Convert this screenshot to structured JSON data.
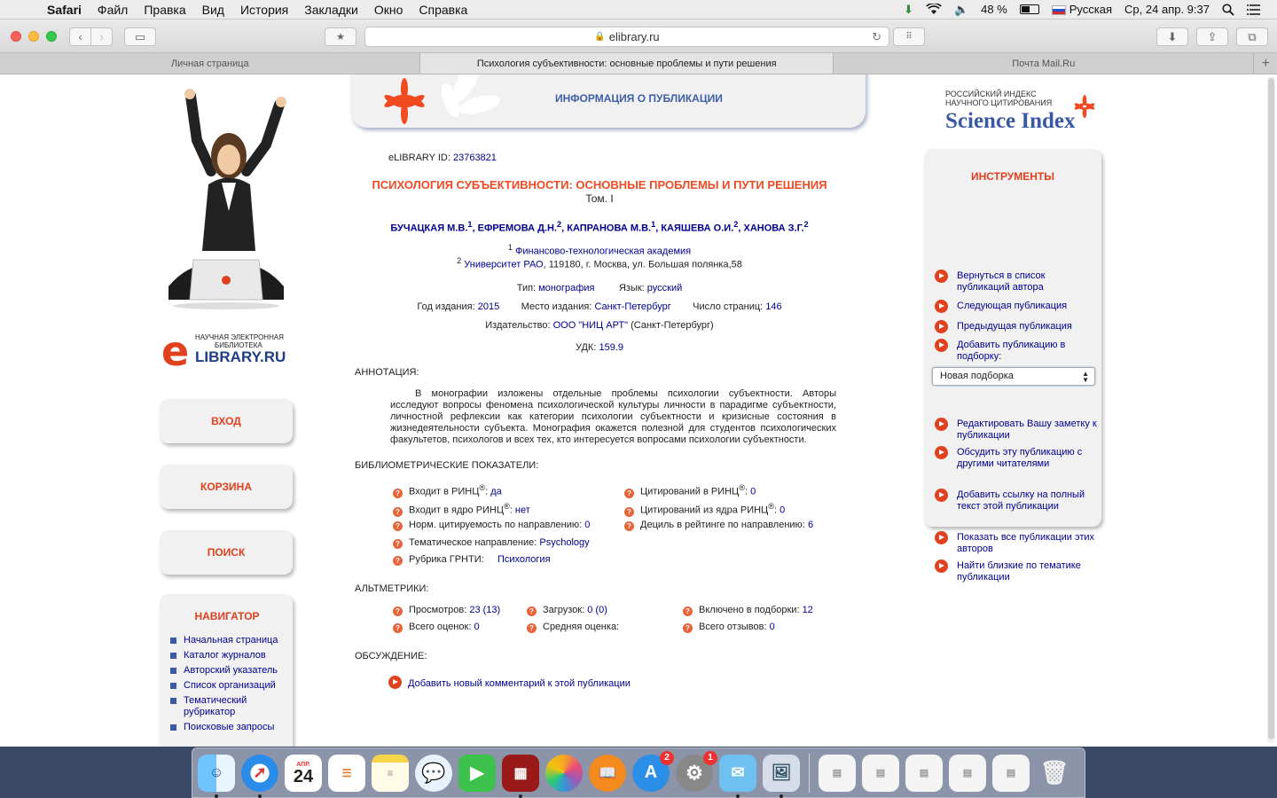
{
  "menubar": {
    "app": "Safari",
    "items": [
      "Файл",
      "Правка",
      "Вид",
      "История",
      "Закладки",
      "Окно",
      "Справка"
    ],
    "battery": "48 %",
    "input_source": "Русская",
    "datetime": "Ср, 24 апр.  9:37"
  },
  "browser": {
    "url": "elibrary.ru",
    "tabs": [
      {
        "label": "Личная страница"
      },
      {
        "label": "Психология субъективности: основные проблемы и пути решения"
      },
      {
        "label": "Почта Mail.Ru"
      }
    ]
  },
  "left": {
    "logo_small_line1": "НАУЧНАЯ ЭЛЕКТРОННАЯ",
    "logo_small_line2": "БИБЛИОТЕКА",
    "logo_big": "LIBRARY.RU",
    "logo_e": "e",
    "login": "ВХОД",
    "cart": "КОРЗИНА",
    "search": "ПОИСК",
    "navigator_title": "НАВИГАТОР",
    "nav_items": [
      "Начальная страница",
      "Каталог журналов",
      "Авторский указатель",
      "Список организаций",
      "Тематический рубрикатор",
      "Поисковые запросы"
    ]
  },
  "header": {
    "title": "ИНФОРМАЦИЯ О ПУБЛИКАЦИИ"
  },
  "publication": {
    "id_label": "eLIBRARY ID:",
    "id_value": "23763821",
    "title": "ПСИХОЛОГИЯ СУБЪЕКТИВНОСТИ: ОСНОВНЫЕ ПРОБЛЕМЫ И ПУТИ РЕШЕНИЯ",
    "volume": "Том. I",
    "authors": [
      {
        "name": "БУЧАЦКАЯ М.В.",
        "sup": "1"
      },
      {
        "name": "ЕФРЕМОВА Д.Н.",
        "sup": "2"
      },
      {
        "name": "КАПРАНОВА М.В.",
        "sup": "1"
      },
      {
        "name": "КАЯШЕВА О.И.",
        "sup": "2"
      },
      {
        "name": "ХАНОВА З.Г.",
        "sup": "2"
      }
    ],
    "aff1_sup": "1",
    "aff1": "Финансово-технологическая академия",
    "aff2_sup": "2",
    "aff2_link": "Университет РАО",
    "aff2_rest": ", 119180, г. Москва, ул. Большая полянка,58",
    "type_label": "Тип:",
    "type_value": "монография",
    "lang_label": "Язык:",
    "lang_value": "русский",
    "year_label": "Год издания:",
    "year_value": "2015",
    "place_label": "Место издания:",
    "place_value": "Санкт-Петербург",
    "pages_label": "Число страниц:",
    "pages_value": "146",
    "publisher_label": "Издательство:",
    "publisher_value": "ООО \"НИЦ АРТ\"",
    "publisher_city": "(Санкт-Петербург)",
    "udk_label": "УДК:",
    "udk_value": "159.9",
    "annotation_head": "АННОТАЦИЯ:",
    "annotation": "В монографии изложены отдельные проблемы психологии субъектности. Авторы исследуют вопросы феномена психологической культуры личности в парадигме субъектности, личностной рефлексии как категории психологии субъектности и кризисные состояния в жизнедеятельности субъекта. Монография окажется полезной для студентов психологических факультетов, психологов и всех тех, кто интересуется вопросами психологии субъектности."
  },
  "biblio": {
    "head": "БИБЛИОМЕТРИЧЕСКИЕ ПОКАЗАТЕЛИ:",
    "rinc_label": "Входит в РИНЦ",
    "rinc_value": "да",
    "core_label": "Входит в ядро РИНЦ",
    "core_value": "нет",
    "norm_label": "Норм. цитируемость по направлению:",
    "norm_value": "0",
    "topic_label": "Тематическое направление:",
    "topic_value": "Psychology",
    "grnti_label": "Рубрика ГРНТИ:",
    "grnti_value": "Психология",
    "cit_label": "Цитирований в РИНЦ",
    "cit_value": "0",
    "cit_core_label": "Цитирований из ядра РИНЦ",
    "cit_core_value": "0",
    "decile_label": "Дециль в рейтинге по направлению:",
    "decile_value": "6",
    "reg": "®"
  },
  "altmetrics": {
    "head": "АЛЬТМЕТРИКИ:",
    "views_label": "Просмотров:",
    "views_value": "23 (13)",
    "downloads_label": "Загрузок:",
    "downloads_value": "0 (0)",
    "collections_label": "Включено в подборки:",
    "collections_value": "12",
    "ratings_label": "Всего оценок:",
    "ratings_value": "0",
    "avg_label": "Средняя оценка:",
    "reviews_label": "Всего отзывов:",
    "reviews_value": "0"
  },
  "discussion": {
    "head": "ОБСУЖДЕНИЕ:",
    "add_comment": "Добавить новый комментарий к этой публикации"
  },
  "right": {
    "si_small1": "РОССИЙСКИЙ ИНДЕКС",
    "si_small2": "НАУЧНОГО ЦИТИРОВАНИЯ",
    "si_big": "Science Index",
    "tools_title": "ИНСТРУМЕНТЫ",
    "tools": [
      "Вернуться в список публикаций автора",
      "Следующая публикация",
      "Предыдущая публикация",
      "Добавить публикацию в подборку:",
      "Редактировать Вашу заметку к публикации",
      "Обсудить эту публикацию с другими читателями",
      "Добавить ссылку на полный текст этой публикации",
      "Показать все публикации этих авторов",
      "Найти близкие по тематике публикации"
    ],
    "select_value": "Новая подборка"
  },
  "dock": {
    "calendar_month": "АПР.",
    "calendar_day": "24",
    "appstore_badge": "2",
    "prefs_badge": "1"
  }
}
